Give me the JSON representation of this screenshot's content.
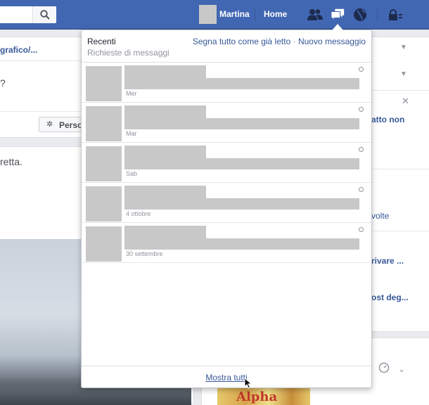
{
  "topbar": {
    "user_name": "Martina",
    "home_label": "Home"
  },
  "icons": {
    "search": "search-icon",
    "friends": "friends-icon",
    "messages": "messages-icon",
    "notifications": "globe-icon",
    "privacy": "lock-icon"
  },
  "background": {
    "left_link": "grafico/...",
    "left_question": "?",
    "left_button": "Perso",
    "left_post_text": "retta.",
    "right_texts": [
      "atto non",
      "volte",
      "rivare ...",
      "ost deg..."
    ],
    "game_text": "Alpha"
  },
  "messages_panel": {
    "title": "Recenti",
    "subtitle": "Richieste di messaggi",
    "mark_all_read": "Segna tutto come già letto",
    "separator": "·",
    "new_message": "Nuovo messaggio",
    "items": [
      {
        "time": "Mer"
      },
      {
        "time": "Mar"
      },
      {
        "time": "Sab"
      },
      {
        "time": "4 ottobre"
      },
      {
        "time": "30 settembre"
      }
    ],
    "show_all": "Mostra tutti"
  },
  "colors": {
    "brand_blue": "#4267b2",
    "link_blue": "#365899",
    "placeholder_gray": "#c8c8c8"
  }
}
